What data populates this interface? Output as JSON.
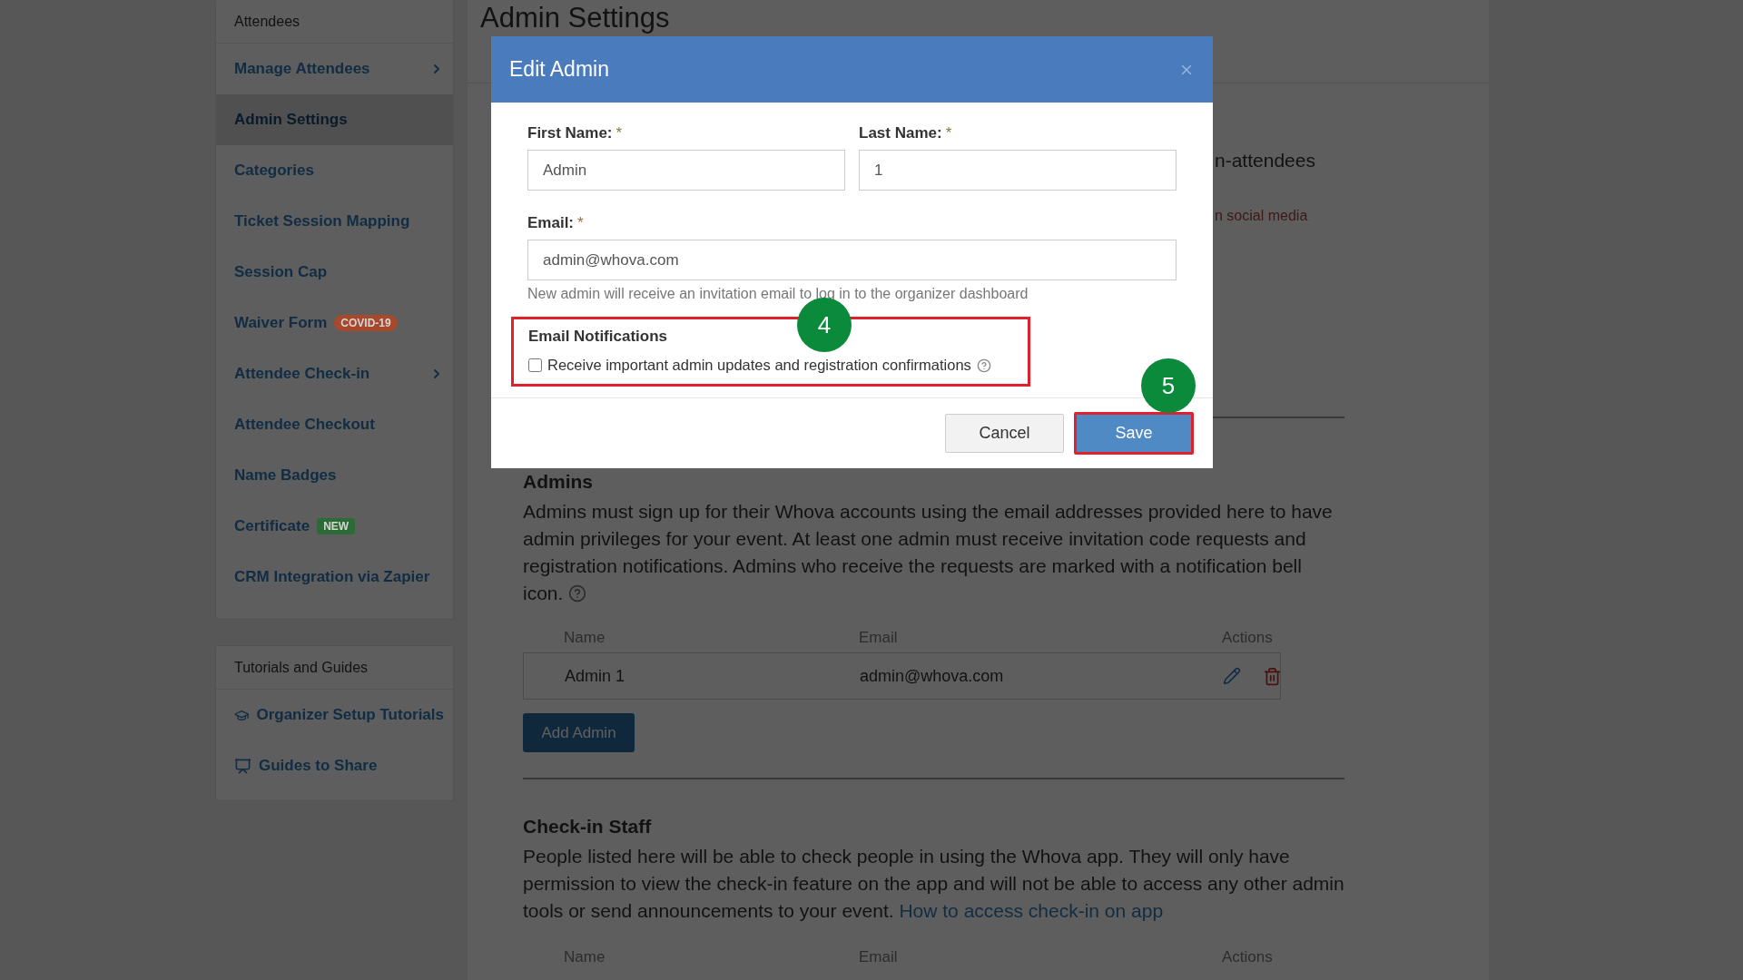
{
  "sidebar": {
    "sections": [
      {
        "title": "Attendees",
        "items": [
          {
            "label": "Manage Attendees",
            "selected": false,
            "has_submenu": true
          },
          {
            "label": "Admin Settings",
            "selected": true,
            "has_submenu": false
          },
          {
            "label": "Categories",
            "selected": false,
            "has_submenu": false
          },
          {
            "label": "Ticket Session Mapping",
            "selected": false,
            "has_submenu": false
          },
          {
            "label": "Session Cap",
            "selected": false,
            "has_submenu": false
          },
          {
            "label": "Waiver Form",
            "selected": false,
            "has_submenu": false,
            "badge": {
              "text": "COVID-19",
              "color": "#a8492c"
            }
          },
          {
            "label": "Attendee Check-in",
            "selected": false,
            "has_submenu": true
          },
          {
            "label": "Attendee Checkout",
            "selected": false,
            "has_submenu": false
          },
          {
            "label": "Name Badges",
            "selected": false,
            "has_submenu": false
          },
          {
            "label": "Certificate",
            "selected": false,
            "has_submenu": false,
            "badge": {
              "text": "NEW",
              "color": "#2c6b35"
            }
          },
          {
            "label": "CRM Integration via Zapier",
            "selected": false,
            "has_submenu": false
          }
        ]
      },
      {
        "title": "Tutorials and Guides",
        "items": [
          {
            "label": "Organizer Setup Tutorials",
            "selected": false,
            "has_submenu": false
          },
          {
            "label": "Guides to Share",
            "selected": false,
            "has_submenu": false
          }
        ]
      }
    ]
  },
  "page": {
    "title": "Admin Settings",
    "fragments": [
      {
        "text": "n-attendees",
        "kind": "heading"
      },
      {
        "text": "n social media",
        "kind": "link"
      }
    ],
    "admins": {
      "title": "Admins",
      "description": "Admins must sign up for their Whova accounts using the email addresses provided here to have admin privileges for your event. At least one admin must receive invitation code requests and registration notifications. Admins who receive the requests are marked with a notification bell icon.",
      "columns": [
        "Name",
        "Email",
        "Actions"
      ],
      "rows": [
        {
          "name": "Admin 1",
          "email": "admin@whova.com"
        }
      ],
      "add_button": "Add Admin"
    },
    "checkin_staff": {
      "title": "Check-in Staff",
      "description": "People listed here will be able to check people in using the Whova app. They will only have permission to view the check-in feature on the app and will not be able to access any other admin tools or send announcements to your event.",
      "link": "How to access check-in on app",
      "columns": [
        "Name",
        "Email",
        "Actions"
      ]
    }
  },
  "modal": {
    "title": "Edit Admin",
    "name_fields": [
      {
        "label": "First Name:",
        "required": true,
        "value": "Admin"
      },
      {
        "label": "Last Name:",
        "required": true,
        "value": "1"
      }
    ],
    "email_field": {
      "label": "Email:",
      "required": true,
      "value": "admin@whova.com"
    },
    "required_mark": "*",
    "help": "New admin will receive an invitation email to log in to the organizer dashboard",
    "notifications": {
      "title": "Email Notifications",
      "label": "Receive important admin updates and registration confirmations",
      "checked": false,
      "highlighted": true,
      "callout": "4"
    },
    "buttons": [
      {
        "label": "Cancel",
        "kind": "secondary",
        "highlighted": false
      },
      {
        "label": "Save",
        "kind": "primary",
        "highlighted": true,
        "callout": "5"
      }
    ]
  }
}
